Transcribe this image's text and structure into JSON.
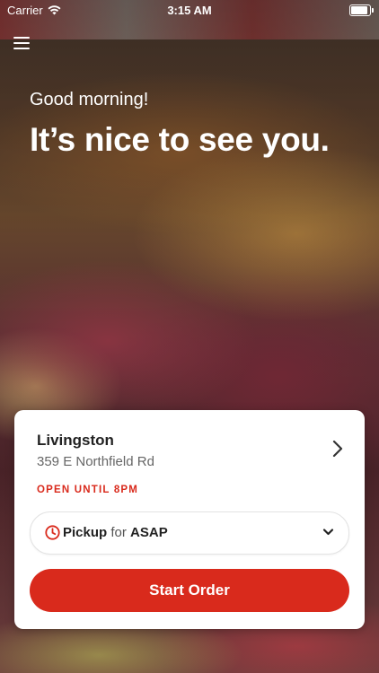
{
  "status_bar": {
    "carrier": "Carrier",
    "time": "3:15 AM",
    "battery_level": 1.0
  },
  "header": {
    "greeting": "Good morning!",
    "headline": "It’s nice to see you."
  },
  "store_card": {
    "name": "Livingston",
    "address": "359 E Northfield Rd",
    "open_status": "OPEN UNTIL 8PM",
    "order_type": {
      "mode": "Pickup",
      "connector": "for",
      "time": "ASAP"
    },
    "start_button_label": "Start Order"
  },
  "colors": {
    "accent": "#d92a1c",
    "text_dark": "#222222",
    "text_muted": "#666666"
  },
  "icons": {
    "menu": "hamburger-menu-icon",
    "wifi": "wifi-icon",
    "battery": "battery-icon",
    "chevron_right": "chevron-right-icon",
    "clock": "clock-icon",
    "chevron_down": "chevron-down-icon"
  }
}
